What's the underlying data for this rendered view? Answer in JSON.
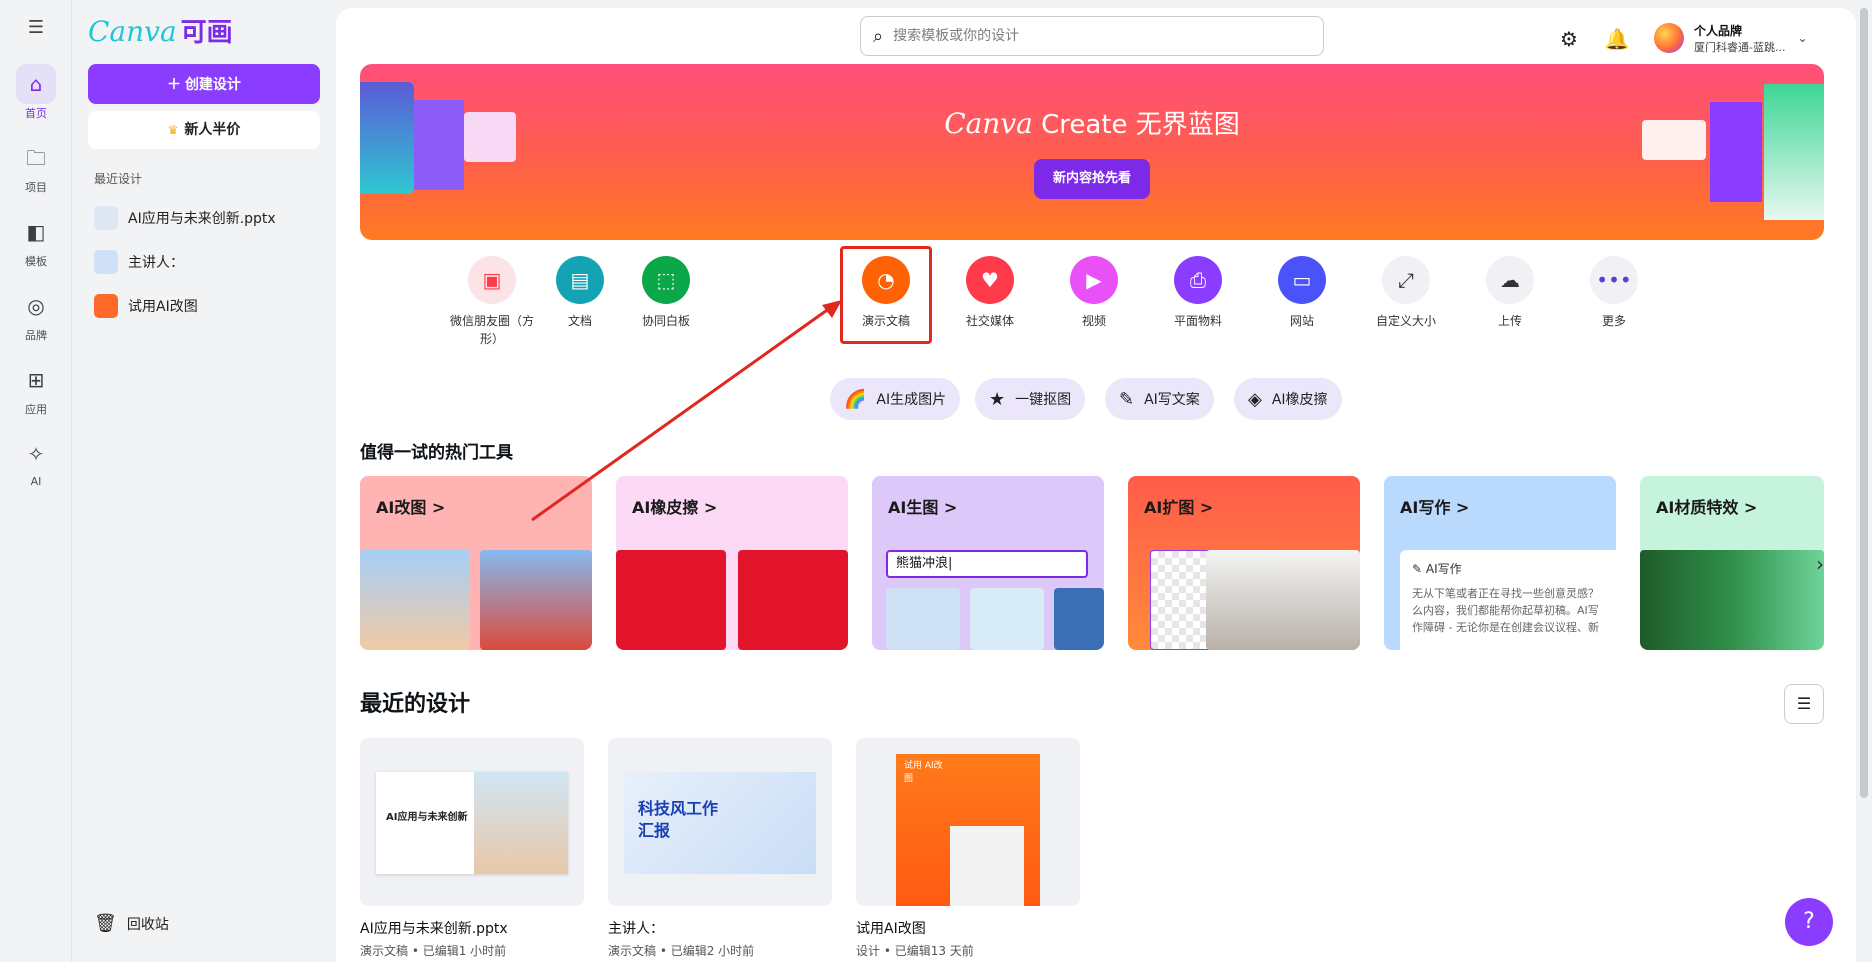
{
  "rail": {
    "items": [
      {
        "label": "首页",
        "icon": "home-icon"
      },
      {
        "label": "项目",
        "icon": "folder-icon"
      },
      {
        "label": "模板",
        "icon": "template-icon"
      },
      {
        "label": "品牌",
        "icon": "brand-icon"
      },
      {
        "label": "应用",
        "icon": "apps-icon"
      },
      {
        "label": "AI",
        "icon": "sparkle-icon"
      }
    ]
  },
  "panel": {
    "logo_text": "Canva",
    "logo_cn": "可画",
    "create_button": "创建设计",
    "half_price_button": "新人半价",
    "recent_title": "最近设计",
    "recent_items": [
      "AI应用与未来创新.pptx",
      "主讲人：",
      "试用AI改图"
    ],
    "trash_label": "回收站"
  },
  "header": {
    "search_placeholder": "搜索模板或你的设计",
    "brand_name": "个人品牌",
    "brand_sub": "厦门科睿通-蓝跳..."
  },
  "hero": {
    "title_canva": "Canva",
    "title_rest": "Create 无界蓝图",
    "button": "新内容抢先看"
  },
  "categories": [
    {
      "label": "微信朋友圈（方形）",
      "icon": "image-icon",
      "color": "#fbe3e6"
    },
    {
      "label": "文档",
      "icon": "doc-icon",
      "color": "#13a3b5"
    },
    {
      "label": "协同白板",
      "icon": "whiteboard-icon",
      "color": "#0ba84a"
    },
    {
      "label": "演示文稿",
      "icon": "presentation-icon",
      "color": "#ff6105"
    },
    {
      "label": "社交媒体",
      "icon": "heart-icon",
      "color": "#ff3b4b"
    },
    {
      "label": "视频",
      "icon": "video-icon",
      "color": "#e950f7"
    },
    {
      "label": "平面物料",
      "icon": "print-icon",
      "color": "#8b3dff"
    },
    {
      "label": "网站",
      "icon": "website-icon",
      "color": "#4a53fa"
    },
    {
      "label": "自定义大小",
      "icon": "resize-icon",
      "color": "#f0f1f4"
    },
    {
      "label": "上传",
      "icon": "upload-icon",
      "color": "#f0f1f4"
    },
    {
      "label": "更多",
      "icon": "more-icon",
      "color": "#f0f1f4"
    }
  ],
  "ai_pills": [
    "AI生成图片",
    "一键抠图",
    "AI写文案",
    "AI橡皮擦"
  ],
  "hot_tools_title": "值得一试的热门工具",
  "tools": [
    {
      "title": "AI改图 >",
      "bg": "#ffb3b3"
    },
    {
      "title": "AI橡皮擦 >",
      "bg": "#fcdaf5"
    },
    {
      "title": "AI生图 >",
      "bg": "#ddc8fa",
      "input": "熊猫冲浪|"
    },
    {
      "title": "AI扩图 >",
      "bg": "#ff6a3d"
    },
    {
      "title": "AI写作 >",
      "bg": "#b9d9fd",
      "card_title": "AI写作",
      "card_text": "无从下笔或者正在寻找一些创意灵感？么内容，我们都能帮你起草初稿。AI写作障碍 - 无论你是在创建会议议程、新"
    },
    {
      "title": "AI材质特效 >",
      "bg": "#c6f3db"
    }
  ],
  "recent_title": "最近的设计",
  "designs": [
    {
      "name": "AI应用与未来创新.pptx",
      "meta": "演示文稿 • 已编辑1 小时前",
      "thumb_text": "AI应用与未来创新"
    },
    {
      "name": "主讲人：",
      "meta": "演示文稿 • 已编辑2 小时前",
      "thumb_text": "科技风工作汇报"
    },
    {
      "name": "试用AI改图",
      "meta": "设计 • 已编辑13 天前",
      "thumb_text": "试用 AI改图"
    }
  ],
  "help_label": "?"
}
